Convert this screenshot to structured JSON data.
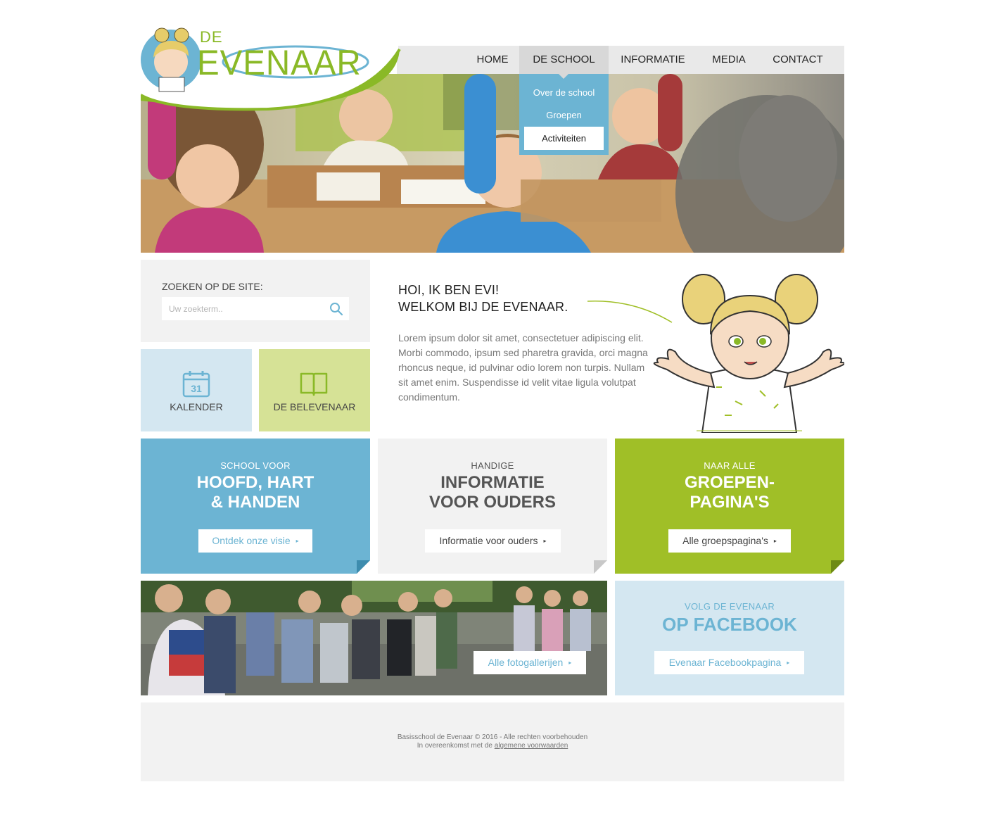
{
  "logo": {
    "prefix": "DE",
    "name": "EVENAAR"
  },
  "nav": {
    "items": [
      {
        "label": "HOME"
      },
      {
        "label": "DE SCHOOL"
      },
      {
        "label": "INFORMATIE"
      },
      {
        "label": "MEDIA"
      },
      {
        "label": "CONTACT"
      }
    ],
    "active": "DE SCHOOL",
    "dropdown": [
      "Over de school",
      "Groepen",
      "Activiteiten"
    ]
  },
  "search": {
    "label": "ZOEKEN OP DE SITE:",
    "placeholder": "Uw zoekterm..",
    "icon": "search-icon"
  },
  "tiles": [
    {
      "label": "KALENDER",
      "icon": "calendar-icon",
      "icon_text": "31"
    },
    {
      "label": "DE BELEVENAAR",
      "icon": "book-icon"
    }
  ],
  "welcome": {
    "title_line1": "HOI, IK BEN EVI!",
    "title_line2": "WELKOM BIJ DE EVENAAR.",
    "body": "Lorem ipsum dolor sit amet, consectetuer adipiscing elit. Morbi commodo, ipsum sed pharetra gravida, orci magna rhoncus neque, id pulvinar odio lorem non turpis. Nullam sit amet enim. Suspendisse id velit vitae ligula volutpat condimentum."
  },
  "promos": [
    {
      "small": "SCHOOL VOOR",
      "big_line1": "HOOFD, HART",
      "big_line2": "& HANDEN",
      "button": "Ontdek onze visie",
      "arrow": "▸"
    },
    {
      "small": "HANDIGE",
      "big_line1": "INFORMATIE",
      "big_line2": "VOOR OUDERS",
      "button": "Informatie voor ouders",
      "arrow": "▸"
    },
    {
      "small": "NAAR ALLE",
      "big_line1": "GROEPEN-",
      "big_line2": "PAGINA'S",
      "button": "Alle groepspagina's",
      "arrow": "▸"
    }
  ],
  "gallery": {
    "button": "Alle fotogallerijen",
    "arrow": "▸"
  },
  "facebook": {
    "small": "VOLG DE EVENAAR",
    "big": "OP FACEBOOK",
    "button": "Evenaar Facebookpagina",
    "arrow": "▸"
  },
  "footer": {
    "line1": "Basisschool de Evenaar © 2016 - Alle rechten voorbehouden",
    "line2_prefix": "In overeenkomst met de",
    "line2_link": "algemene voorwaarden"
  },
  "colors": {
    "blue": "#6cb4d3",
    "light_blue": "#d4e7f1",
    "green": "#a0bf27",
    "light_green": "#d6e296",
    "grey": "#f2f2f2"
  }
}
